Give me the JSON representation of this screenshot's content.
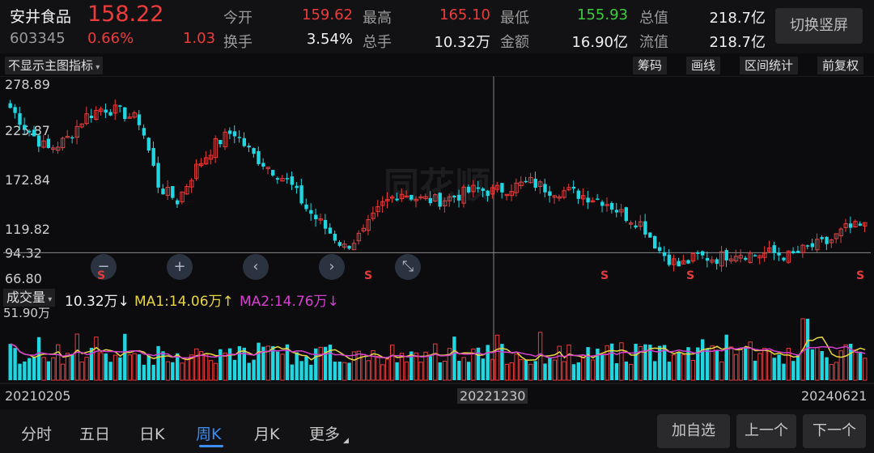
{
  "colors": {
    "up": "#ec3b3b",
    "down": "#20d6e0",
    "ma1": "#e6d640",
    "ma2": "#d63fd0",
    "low": "#3ccd3c",
    "crosshair": "#888888"
  },
  "header": {
    "name": "安井食品",
    "price": "158.22",
    "code": "603345",
    "pct": "0.66%",
    "change": "1.03",
    "switch_label": "切换竖屏",
    "quotes": [
      {
        "label": "今开",
        "value": "159.62"
      },
      {
        "label": "最高",
        "value": "165.10"
      },
      {
        "label": "最低",
        "value": "155.93"
      },
      {
        "label": "总值",
        "value": "218.7亿"
      },
      {
        "label": "换手",
        "value": "3.54%"
      },
      {
        "label": "总手",
        "value": "10.32万"
      },
      {
        "label": "金额",
        "value": "16.90亿"
      },
      {
        "label": "流值",
        "value": "218.7亿"
      }
    ]
  },
  "indicator": {
    "select_label": "不显示主图指标",
    "tools": [
      "筹码",
      "画线",
      "区间统计",
      "前复权"
    ]
  },
  "chart": {
    "y_labels": [
      "278.89",
      "225.87",
      "172.84",
      "119.82",
      "94.32",
      "66.80"
    ],
    "watermark": "同花顺",
    "zoom_buttons": [
      {
        "icon": "minus-icon",
        "glyph": "−"
      },
      {
        "icon": "plus-icon",
        "glyph": "+"
      },
      {
        "icon": "chevron-left-icon",
        "glyph": "‹"
      },
      {
        "icon": "chevron-right-icon",
        "glyph": "›"
      },
      {
        "icon": "shrink-icon",
        "glyph": "⤡"
      }
    ],
    "s_marker": "S"
  },
  "volume": {
    "select_label": "成交量",
    "value": "10.32万↓",
    "ma1": "MA1:14.06万↑",
    "ma2": "MA2:14.76万↓",
    "max_label": "51.90万"
  },
  "dates": {
    "start": "20210205",
    "mid": "20221230",
    "end": "20240621"
  },
  "footer": {
    "tabs": [
      "分时",
      "五日",
      "日K",
      "周K",
      "月K",
      "更多"
    ],
    "active_tab": "周K",
    "buttons": [
      "加自选",
      "上一个",
      "下一个"
    ]
  },
  "chart_data": {
    "type": "candlestick",
    "period": "weekly",
    "y_range": [
      66.8,
      278.89
    ],
    "crosshair_price": 94.32,
    "weeks": 180,
    "trend_close": [
      250,
      225,
      205,
      215,
      240,
      250,
      245,
      235,
      165,
      150,
      185,
      210,
      225,
      200,
      185,
      170,
      140,
      120,
      100,
      115,
      145,
      160,
      152,
      150,
      155,
      162,
      160,
      165,
      170,
      162,
      160,
      155,
      150,
      135,
      125,
      95,
      80,
      90,
      88,
      95,
      92,
      94,
      90,
      100,
      105,
      120,
      122
    ]
  }
}
